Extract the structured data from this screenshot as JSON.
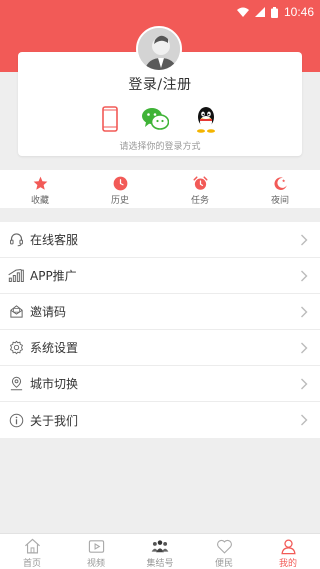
{
  "status_bar": {
    "time": "10:46"
  },
  "login": {
    "title": "登录/注册",
    "hint": "请选择你的登录方式"
  },
  "quick": [
    {
      "label": "收藏",
      "icon": "star-icon"
    },
    {
      "label": "历史",
      "icon": "clock-icon"
    },
    {
      "label": "任务",
      "icon": "alarm-icon"
    },
    {
      "label": "夜间",
      "icon": "moon-icon"
    }
  ],
  "menu": [
    {
      "label": "在线客服",
      "icon": "headset-icon"
    },
    {
      "label": "APP推广",
      "icon": "chart-icon"
    },
    {
      "label": "邀请码",
      "icon": "envelope-icon"
    },
    {
      "label": "系统设置",
      "icon": "gear-icon"
    },
    {
      "label": "城市切换",
      "icon": "location-icon"
    },
    {
      "label": "关于我们",
      "icon": "info-icon"
    }
  ],
  "tabs": [
    {
      "label": "首页",
      "icon": "home-icon"
    },
    {
      "label": "视频",
      "icon": "video-icon"
    },
    {
      "label": "集结号",
      "icon": "group-icon"
    },
    {
      "label": "便民",
      "icon": "heart-icon"
    },
    {
      "label": "我的",
      "icon": "user-icon",
      "active": true
    }
  ],
  "colors": {
    "accent": "#f25a57",
    "wechat": "#3fb337",
    "background": "#eeeeee"
  }
}
